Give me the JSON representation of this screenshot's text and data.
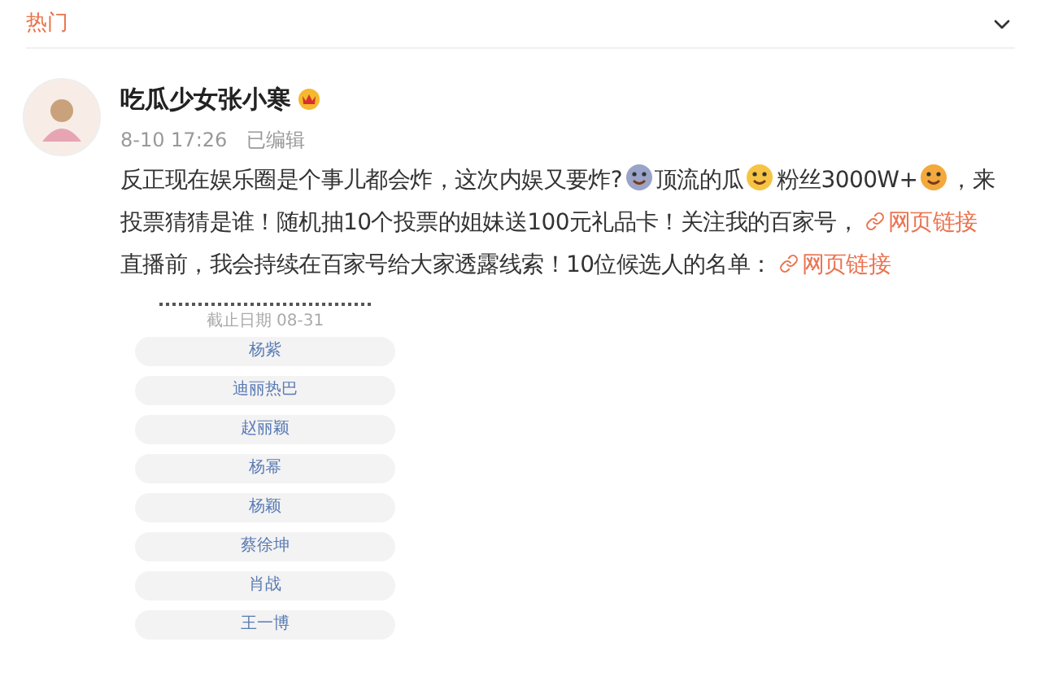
{
  "header": {
    "title": "热门"
  },
  "post": {
    "author": "吃瓜少女张小寒",
    "time": "8-10 17:26",
    "edited": "已编辑",
    "body": [
      {
        "kind": "text",
        "text": "反正现在娱乐圈是个事儿都会炸，这次内娱又要炸?"
      },
      {
        "kind": "emoji"
      },
      {
        "kind": "text",
        "text": "顶流的瓜"
      },
      {
        "kind": "emoji"
      },
      {
        "kind": "text",
        "text": "粉丝3000W+"
      },
      {
        "kind": "emoji"
      },
      {
        "kind": "text",
        "text": "，来投票猜猜是谁！随机抽10个投票的姐妹送100元礼品卡！关注我的百家号，"
      },
      {
        "kind": "link",
        "text": "网页链接"
      },
      {
        "kind": "text",
        "text": " 直播前，我会持续在百家号给大家透露线索！10位候选人的名单："
      },
      {
        "kind": "link",
        "text": "网页链接"
      }
    ],
    "poll": {
      "deadline": "截止日期 08-31",
      "options": [
        "杨紫",
        "迪丽热巴",
        "赵丽颖",
        "杨幂",
        "杨颖",
        "蔡徐坤",
        "肖战",
        "王一博"
      ]
    }
  }
}
